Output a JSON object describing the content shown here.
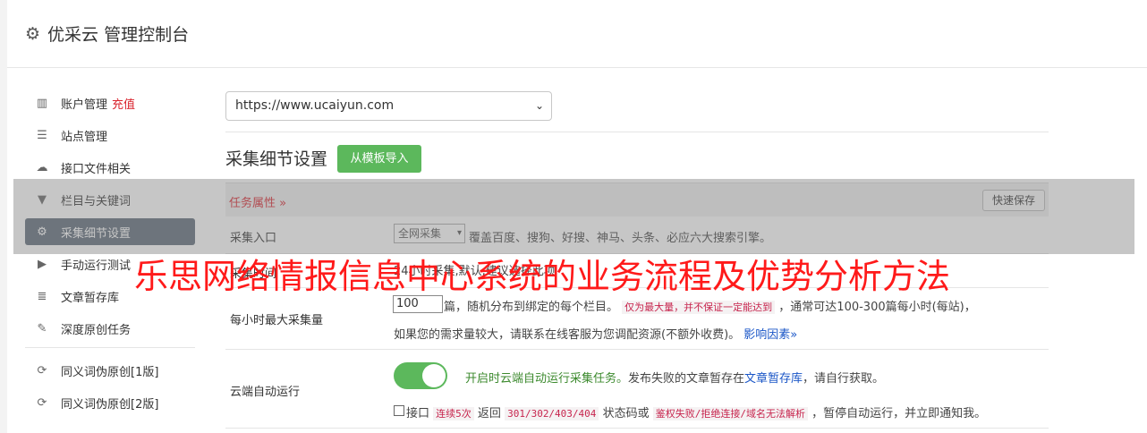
{
  "header": {
    "title": "优采云 管理控制台",
    "icon": "gear-icon"
  },
  "sidebar": {
    "items": [
      {
        "icon": "bar-chart-icon",
        "glyph": "▥",
        "label": "账户管理",
        "extra": "充值"
      },
      {
        "icon": "server-icon",
        "glyph": "☰",
        "label": "站点管理"
      },
      {
        "icon": "cloud-upload-icon",
        "glyph": "☁",
        "label": "接口文件相关"
      },
      {
        "icon": "filter-icon",
        "glyph": "▼",
        "label": "栏目与关键词"
      },
      {
        "icon": "gears-icon",
        "glyph": "⚙",
        "label": "采集细节设置",
        "active": true
      },
      {
        "icon": "play-circle-icon",
        "glyph": "▶",
        "label": "手动运行测试"
      },
      {
        "icon": "database-icon",
        "glyph": "≣",
        "label": "文章暂存库"
      },
      {
        "icon": "edit-icon",
        "glyph": "✎",
        "label": "深度原创任务"
      },
      {
        "icon": "refresh-icon",
        "glyph": "⟳",
        "label": "同义词伪原创[1版]"
      },
      {
        "icon": "refresh-icon",
        "glyph": "⟳",
        "label": "同义词伪原创[2版]"
      }
    ]
  },
  "site_select": {
    "value": "https://www.ucaiyun.com"
  },
  "section": {
    "title": "采集细节设置",
    "import_button": "从模板导入"
  },
  "table": {
    "task_label": "任务属性 »",
    "save_button": "快速保存",
    "rows": {
      "entry": {
        "label": "采集入口",
        "select_value": "全网采集",
        "desc": "覆盖百度、搜狗、好搜、神马、头条、必应六大搜索引擎。"
      },
      "time": {
        "label": "采集时间",
        "desc": "24小时采集,默认,建议选择此项"
      },
      "max": {
        "label": "每小时最大采集量",
        "input_value": "100",
        "text1": "篇，随机分布到绑定的每个栏目。",
        "code1": "仅为最大量，并不保证一定能达到",
        "text2": "，通常可达100-300篇每小时(每站)，",
        "text3": "如果您的需求量较大，请联系在线客服为您调配资源(不额外收费)。",
        "link": "影响因素»"
      },
      "auto": {
        "label": "云端自动运行",
        "toggle_on": true,
        "green_text": "开启时云端自动运行采集任务。",
        "text1": "发布失败的文章暂存在",
        "link": "文章暂存库",
        "text2": "，请自行获取。",
        "chk_text1": "接口",
        "code1": "连续5次",
        "chk_text2": "返回",
        "code2": "301/302/403/404",
        "chk_text3": "状态码或",
        "code3": "鉴权失败/拒绝连接/域名无法解析",
        "chk_text4": "，暂停自动运行，并立即通知我。"
      }
    }
  },
  "banner": {
    "text": "乐思网络情报信息中心系统的业务流程及优势分析方法"
  }
}
